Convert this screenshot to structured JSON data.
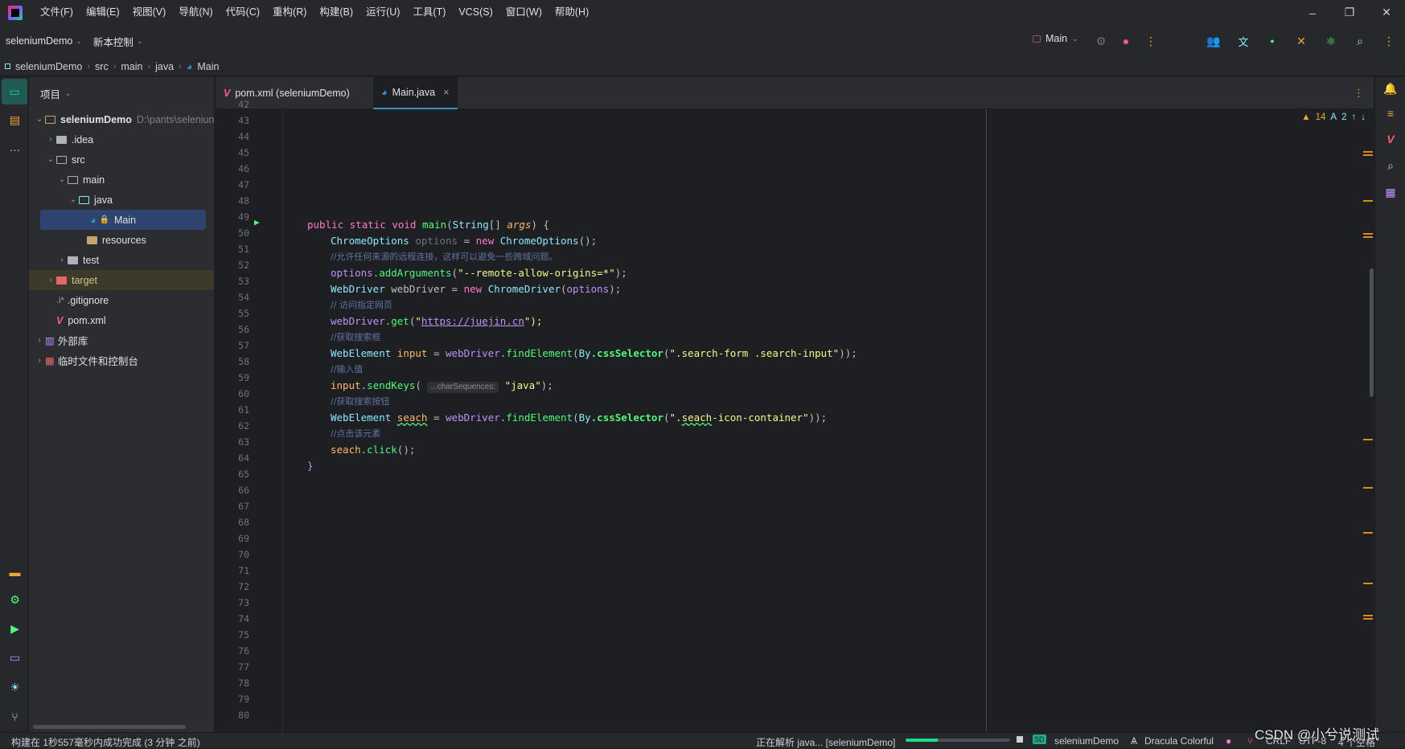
{
  "menu": [
    "文件(F)",
    "编辑(E)",
    "视图(V)",
    "导航(N)",
    "代码(C)",
    "重构(R)",
    "构建(B)",
    "运行(U)",
    "工具(T)",
    "VCS(S)",
    "窗口(W)",
    "帮助(H)"
  ],
  "toolbar": {
    "project": "seleniumDemo",
    "vcs": "新本控制",
    "run_config": "Main"
  },
  "breadcrumb": [
    "seleniumDemo",
    "src",
    "main",
    "java",
    "Main"
  ],
  "project_panel": {
    "title": "项目",
    "tree": [
      {
        "label": "seleniumDemo",
        "extra": "D:\\pants\\seleniun",
        "depth": 0,
        "arrow": "v"
      },
      {
        "label": ".idea",
        "depth": 1,
        "arrow": ">"
      },
      {
        "label": "src",
        "depth": 1,
        "arrow": "v"
      },
      {
        "label": "main",
        "depth": 2,
        "arrow": "v"
      },
      {
        "label": "java",
        "depth": 3,
        "arrow": "v"
      },
      {
        "label": "Main",
        "depth": 4,
        "arrow": ""
      },
      {
        "label": "resources",
        "depth": 3,
        "arrow": ""
      },
      {
        "label": "test",
        "depth": 2,
        "arrow": ">"
      },
      {
        "label": "target",
        "depth": 1,
        "arrow": ">"
      },
      {
        "label": ".gitignore",
        "depth": 1,
        "arrow": ""
      },
      {
        "label": "pom.xml",
        "depth": 1,
        "arrow": ""
      },
      {
        "label": "外部库",
        "depth": 0,
        "arrow": ">"
      },
      {
        "label": "临时文件和控制台",
        "depth": 0,
        "arrow": ">"
      }
    ]
  },
  "tabs": [
    {
      "label": "pom.xml (seleniumDemo)",
      "active": false
    },
    {
      "label": "Main.java",
      "active": true,
      "close": "×"
    }
  ],
  "editor": {
    "warnings": "14",
    "typos": "2",
    "line_numbers": [
      "42",
      "43",
      "44",
      "45",
      "46",
      "47",
      "48",
      "49",
      "50",
      "51",
      "52",
      "53",
      "54",
      "55",
      "56",
      "57",
      "58",
      "59",
      "60",
      "61",
      "62",
      "63",
      "64",
      "65",
      "66",
      "67",
      "68",
      "69",
      "70",
      "71",
      "72",
      "73",
      "74",
      "75",
      "76",
      "77",
      "78",
      "79",
      "80"
    ],
    "code": {
      "l49_kw": "public static void ",
      "l49_fn": "main",
      "l49_ty": "String",
      "l49_rest": "[] ",
      "l49_par": "args",
      "l49_end": ") {",
      "l50_ty": "ChromeOptions",
      "l50_var": " options",
      "l50_eq": " = ",
      "l50_new": "new ",
      "l50_ctor": "ChromeOptions",
      "l50_end": "();",
      "l51": "//允许任何来源的远程连接，这样可以避免一些跨域问题。",
      "l52_obj": "options",
      "l52_fn": ".addArguments",
      "l52_str": "\"--remote-allow-origins=*\"",
      "l52_end": ");",
      "l53_ty": "WebDriver",
      "l53_var": " webDriver",
      "l53_eq": " = ",
      "l53_new": "new ",
      "l53_ctor": "ChromeDriver",
      "l53_arg": "options",
      "l53_end": ");",
      "l54": "// 访问指定网页",
      "l55_obj": "webDriver",
      "l55_fn": ".get",
      "l55_q": "\"",
      "l55_url": "https://juejin.cn",
      "l55_end": "\");",
      "l56": "//获取搜索框",
      "l57_ty": "WebElement",
      "l57_var": " input",
      "l57_mid": " = ",
      "l57_obj": "webDriver",
      "l57_fn": ".findElement",
      "l57_by": "By",
      "l57_sel": ".cssSelector",
      "l57_str": "\".search-form .search-input\"",
      "l57_end": "));",
      "l58": "//输入值",
      "l59_obj": "input",
      "l59_fn": ".sendKeys",
      "l59_hint": "...charSequences:",
      "l59_str": "\"java\"",
      "l59_end": ");",
      "l60": "//获取搜索按钮",
      "l61_ty": "WebElement",
      "l61_var": "seach",
      "l61_mid": " = ",
      "l61_obj": "webDriver",
      "l61_fn": ".findElement",
      "l61_by": "By",
      "l61_sel": ".cssSelector",
      "l61_str1": "\".",
      "l61_str2": "seach",
      "l61_str3": "-icon-container\"",
      "l61_end": "));",
      "l62": "//点击该元素",
      "l63_obj": "seach",
      "l63_fn": ".click",
      "l63_end": "();",
      "l64": "}"
    }
  },
  "statusbar": {
    "left": "构建在 1秒557毫秒内成功完成 (3 分钟 之前)",
    "parsing": "正在解析 java... [seleniumDemo]",
    "project_badge": "SD",
    "project": "seleniumDemo",
    "theme": "Dracula Colorful",
    "line_sep": "CRLF",
    "encoding": "UTF-8",
    "indent": "4 个空格",
    "watermark": "CSDN @小兮说测试"
  },
  "colors": {
    "accent": "#3592c4",
    "selection": "#2e436e",
    "warning": "#e08a1e"
  }
}
